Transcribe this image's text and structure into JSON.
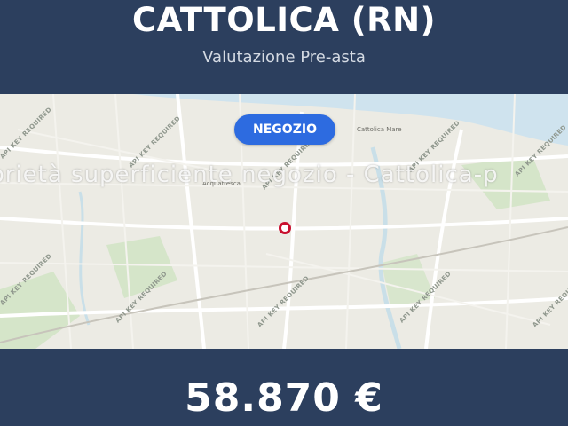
{
  "header": {
    "title": "CATTOLICA (RN)",
    "subtitle": "Valutazione Pre-asta"
  },
  "map": {
    "category_badge": "NEGOZIO",
    "watermark": "iprietà superficiente negozio - Cattolica-p",
    "api_label": "API KEY REQUIRED",
    "place_labels": {
      "top_right": "Cattolica Mare",
      "center_left": "Acquafresca"
    },
    "colors": {
      "land": "#ecebe4",
      "sea": "#cfe3ee",
      "park": "#cfe2c2",
      "road": "#ffffff",
      "marker": "#c8102e"
    }
  },
  "footer": {
    "price": "58.870 €"
  },
  "colors": {
    "background": "#2c3f5e",
    "badge": "#2d6be0",
    "title_text": "#ffffff"
  }
}
